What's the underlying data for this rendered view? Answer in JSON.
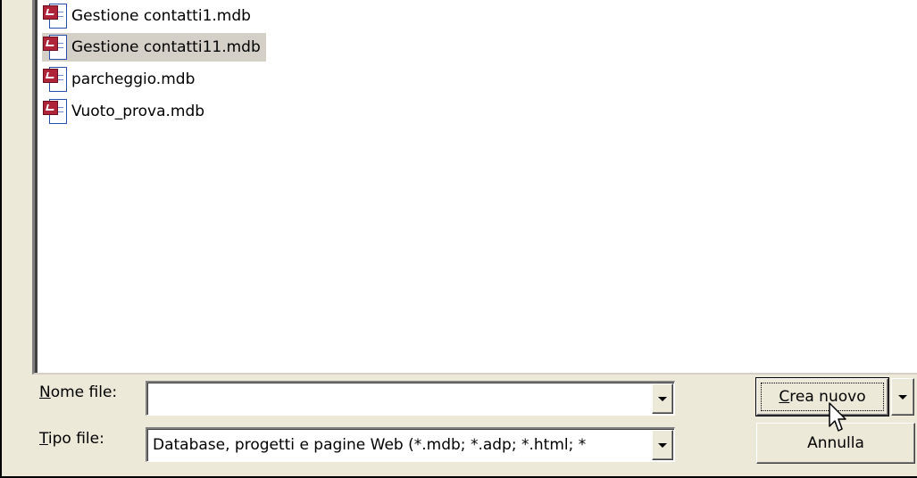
{
  "files": [
    {
      "name": "Gestione contatti1.mdb",
      "selected": false,
      "icon": "access-database-icon"
    },
    {
      "name": "Gestione contatti11.mdb",
      "selected": true,
      "icon": "access-database-icon"
    },
    {
      "name": "parcheggio.mdb",
      "selected": false,
      "icon": "access-database-icon"
    },
    {
      "name": "Vuoto_prova.mdb",
      "selected": false,
      "icon": "access-database-icon"
    }
  ],
  "form": {
    "filename_label": "Nome file:",
    "filename_value": "",
    "filetype_label": "Tipo file:",
    "filetype_value": "Database, progetti e pagine Web (*.mdb; *.adp; *.html; *"
  },
  "buttons": {
    "create_label": "Crea nuovo",
    "cancel_label": "Annulla"
  },
  "colors": {
    "dialog_bg": "#ece9d8",
    "list_bg": "#ffffff",
    "selection_bg": "#d4d0c8"
  }
}
